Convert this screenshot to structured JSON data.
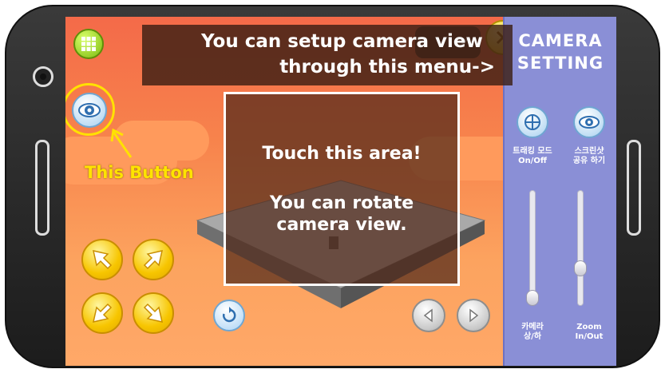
{
  "captions": {
    "top_line1": "You can setup camera view",
    "top_line2": "through this menu->",
    "touch_line1": "Touch this area!",
    "touch_line2": "You can rotate",
    "touch_line3": "camera view.",
    "this_button": "This Button"
  },
  "panel": {
    "title_line1": "CAMERA",
    "title_line2": "SETTING",
    "tracking_label_line1": "트래킹 모드",
    "tracking_label_line2": "On/Off",
    "share_label_line1": "스크린샷",
    "share_label_line2": "공유 하기",
    "camera_slider_label_line1": "카메라",
    "camera_slider_label_line2": "상/하",
    "zoom_slider_label_line1": "Zoom",
    "zoom_slider_label_line2": "In/Out",
    "camera_slider_value": 0.0,
    "zoom_slider_value": 0.3
  },
  "colors": {
    "highlight_yellow": "#ffe100",
    "panel_bg": "#8a8fd6",
    "grid_button": "#7dbb10",
    "arrow_button": "#f7c500"
  },
  "icons": [
    "grid-icon",
    "eye-icon",
    "close-icon",
    "rotate-reset-icon",
    "arrow-left-icon",
    "arrow-right-icon",
    "crosshair-icon",
    "dropdown-chevron-icon"
  ]
}
